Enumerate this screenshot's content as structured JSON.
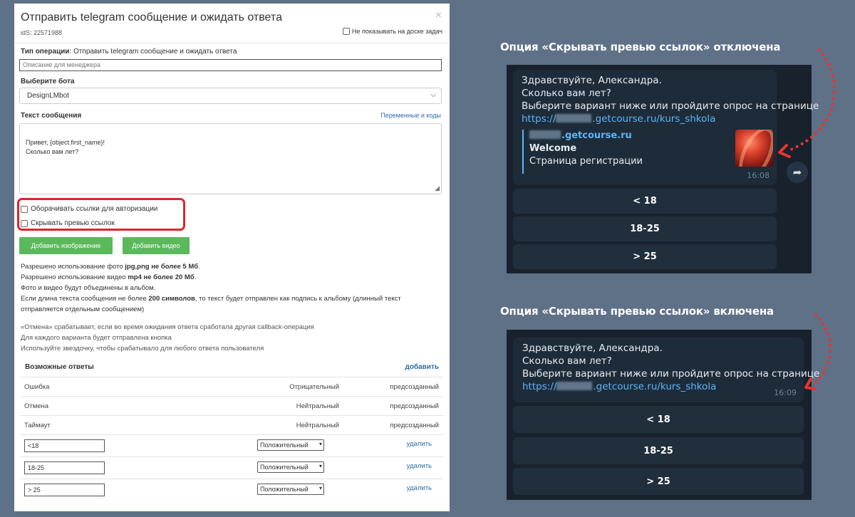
{
  "modal": {
    "title": "Отправить telegram сообщение и ожидать ответа",
    "close": "×",
    "id_label": "idS: 22571988",
    "no_show_label": "Не показывать на доске задач",
    "operation_type_label": "Тип операции",
    "operation_type_value": ": Отправить telegram сообщение и ожидать ответа",
    "description_placeholder": "Описание для менеджера",
    "bot_label": "Выберите бота",
    "bot_value": "DesignLMbot",
    "message_label": "Текст сообщения",
    "vars_link": "Переменные и коды",
    "message_text": "Привет, {object.first_name}!\nСколько вам лет?",
    "option_wrap_links": "Оборачивать ссылки для авторизации",
    "option_hide_preview": "Скрывать превью ссылок",
    "btn_add_image": "Добавить изображение",
    "btn_add_video": "Добавить видео",
    "info": {
      "l1a": "Разрешено использование фото ",
      "l1b": "jpg,png не более 5 Мб",
      "l1c": ".",
      "l2a": "Разрешено использование видео ",
      "l2b": "mp4 не более 20 Мб",
      "l2c": ".",
      "l3": "Фото и видео будут объединены в альбом.",
      "l4a": "Если длина текста сообщения не более ",
      "l4b": "200 символов",
      "l4c": ", то текст будет отправлен как подпись к альбому (длинный текст",
      "l5": "отправляется отдельным сообщением)"
    },
    "info2": {
      "l1": "«Отмена» срабатывает, если во время ожидания ответа сработала другая callback-операция",
      "l2": "Для каждого варианта будет отправлена кнопка",
      "l3": "Используйте звездочку, чтобы срабатывало для любого ответа пользователя"
    },
    "answers_title": "Возможные ответы",
    "add_link": "добавить",
    "fixed_answers": [
      {
        "name": "Ошибка",
        "type": "Отрицательный",
        "origin": "предсозданный"
      },
      {
        "name": "Отмена",
        "type": "Нейтральный",
        "origin": "предсозданный"
      },
      {
        "name": "Таймаут",
        "type": "Нейтральный",
        "origin": "предсозданный"
      }
    ],
    "edit_answers": [
      {
        "value": "<18",
        "type": "Положительный",
        "delete": "удалить"
      },
      {
        "value": "18-25",
        "type": "Положительный",
        "delete": "удалить"
      },
      {
        "value": "> 25",
        "type": "Положительный",
        "delete": "удалить"
      }
    ]
  },
  "right": {
    "heading_off": "Опция «Скрывать превью ссылок» отключена",
    "heading_on": "Опция «Скрывать превью ссылок» включена",
    "msg_lines": [
      "Здравствуйте, Александра.",
      "Сколько вам лет?",
      "Выберите вариант ниже или пройдите опрос на странице"
    ],
    "link_prefix": "https://",
    "link_suffix": ".getcourse.ru/kurs_shkola",
    "preview_site_suffix": ".getcourse.ru",
    "preview_title": "Welcome",
    "preview_desc": "Страница регистрации",
    "time_off": "16:08",
    "time_on": "16:09",
    "buttons": [
      "< 18",
      "18-25",
      "> 25"
    ]
  },
  "colors": {
    "background": "#5f7187",
    "highlight_red": "#d9272e",
    "green_button": "#5cb85c",
    "telegram_bg": "#18222d",
    "telegram_link": "#5eb5f7"
  }
}
